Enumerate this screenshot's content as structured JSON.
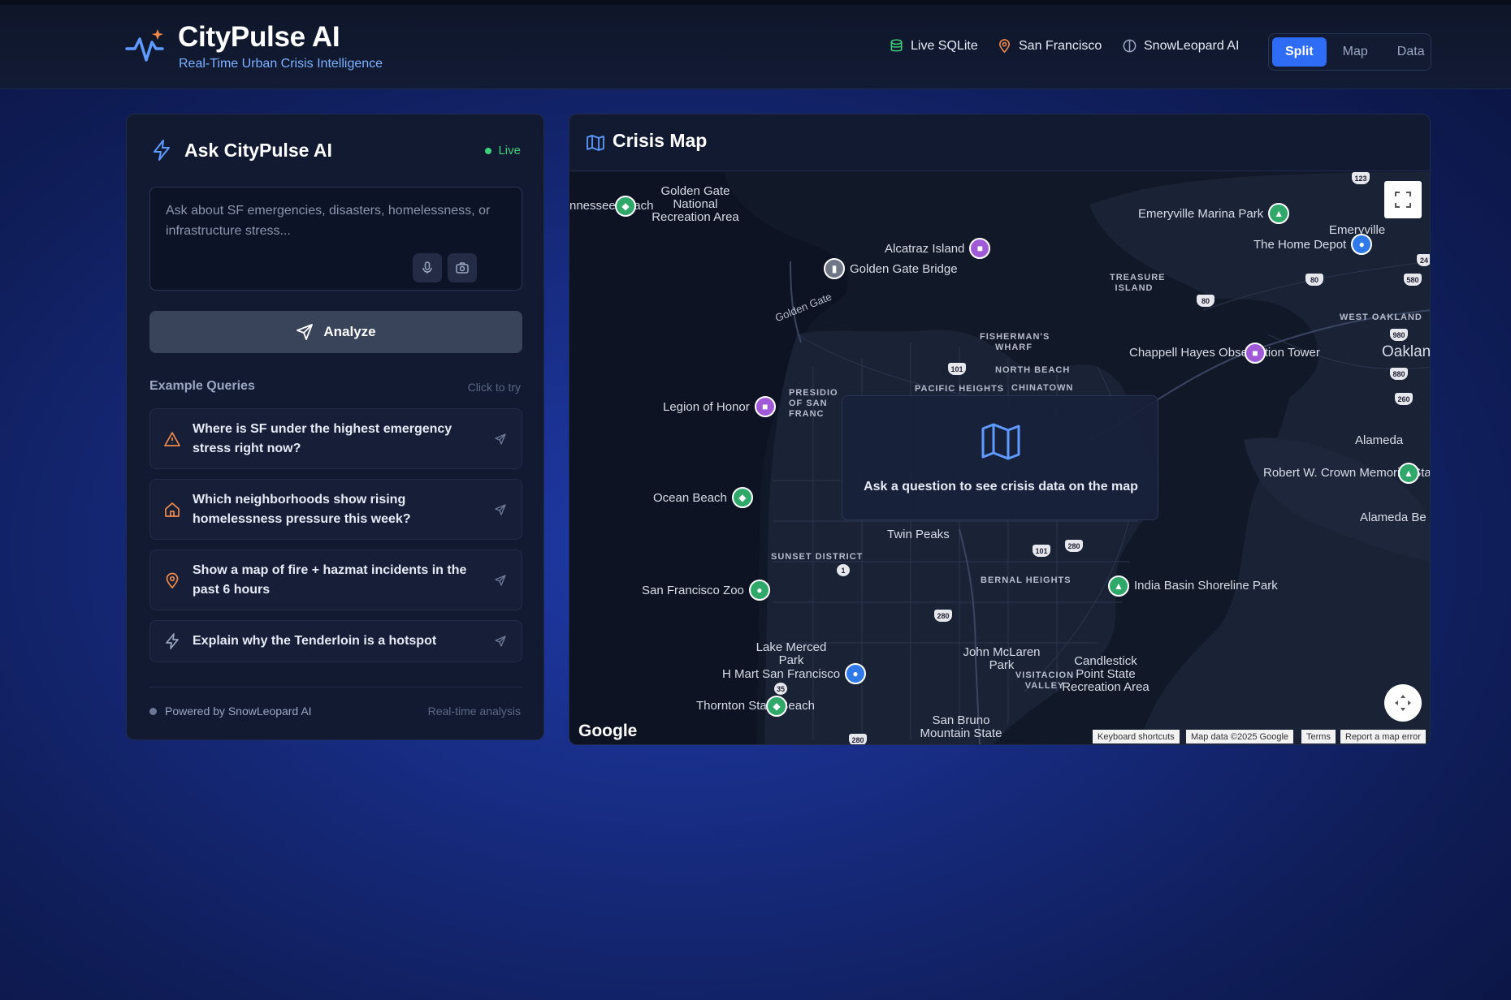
{
  "header": {
    "app_title": "CityPulse AI",
    "app_subtitle": "Real-Time Urban Crisis Intelligence",
    "status": {
      "database": "Live SQLite",
      "location": "San Francisco",
      "engine": "SnowLeopard AI"
    },
    "view_modes": [
      "Split",
      "Map",
      "Data"
    ],
    "active_view": "Split"
  },
  "ask_panel": {
    "title": "Ask CityPulse AI",
    "live_label": "Live",
    "query_placeholder": "Ask about SF emergencies, disasters, homelessness, or infrastructure stress...",
    "analyze_label": "Analyze",
    "examples_title": "Example Queries",
    "examples_hint": "Click to try",
    "examples": [
      {
        "text": "Where is SF under the highest emergency stress right now?",
        "icon": "warning-triangle-icon",
        "color": "#f08a4b"
      },
      {
        "text": "Which neighborhoods show rising homelessness pressure this week?",
        "icon": "home-icon",
        "color": "#f08a4b"
      },
      {
        "text": "Show a map of fire + hazmat incidents in the past 6 hours",
        "icon": "map-pin-icon",
        "color": "#f08a4b"
      },
      {
        "text": "Explain why the Tenderloin is a hotspot",
        "icon": "lightning-icon",
        "color": "#9aa6c2"
      }
    ],
    "footer_powered": "Powered by SnowLeopard AI",
    "footer_realtime": "Real-time analysis"
  },
  "map_panel": {
    "title": "Crisis Map",
    "overlay_text": "Ask a question to see crisis data on the map",
    "google_logo": "Google",
    "attribution": [
      "Keyboard shortcuts",
      "Map data ©2025 Google",
      "Terms",
      "Report a map error"
    ],
    "pois": {
      "golden_gate_nra": "Golden Gate National Recreation Area",
      "tennessee_beach": "nnessee Beach",
      "emeryville_marina": "Emeryville Marina Park",
      "emeryville": "Emeryville",
      "home_depot": "The Home Depot",
      "alcatraz": "Alcatraz Island",
      "golden_gate_bridge": "Golden Gate Bridge",
      "treasure_island": "TREASURE ISLAND",
      "golden_gate_road": "Golden Gate",
      "fishermans_wharf": "FISHERMAN'S WHARF",
      "west_oakland": "WEST OAKLAND",
      "oakland": "Oaklan",
      "chappell_hayes": "Chappell Hayes Observation Tower",
      "north_beach": "NORTH BEACH",
      "pacific_heights": "PACIFIC HEIGHTS",
      "chinatown": "CHINATOWN",
      "presidio": "PRESIDIO OF SAN FRANC",
      "legion_of_honor": "Legion of Honor",
      "alameda": "Alameda",
      "crown_beach": "Robert W. Crown Memorial State Beach",
      "alameda_be": "Alameda Be",
      "ocean_beach": "Ocean Beach",
      "twin_peaks": "Twin Peaks",
      "sunset_district": "SUNSET DISTRICT",
      "bernal_heights": "BERNAL HEIGHTS",
      "india_basin": "India Basin Shoreline Park",
      "sf_zoo": "San Francisco Zoo",
      "lake_merced": "Lake Merced Park",
      "john_mclaren": "John McLaren Park",
      "visitacion_valley": "VISITACION VALLEY",
      "candlestick": "Candlestick Point State Recreation Area",
      "hmart": "H Mart San Francisco",
      "thornton": "Thornton State Beach",
      "san_bruno": "San Bruno Mountain State"
    },
    "highways": [
      "123",
      "24",
      "80",
      "80",
      "580",
      "101",
      "980",
      "880",
      "260",
      "101",
      "280",
      "1",
      "280",
      "35",
      "280"
    ]
  },
  "colors": {
    "accent_blue": "#2f6cf6",
    "live_green": "#3ecf7a",
    "subtitle_blue": "#7cb2ff",
    "warning_orange": "#f08a4b"
  }
}
